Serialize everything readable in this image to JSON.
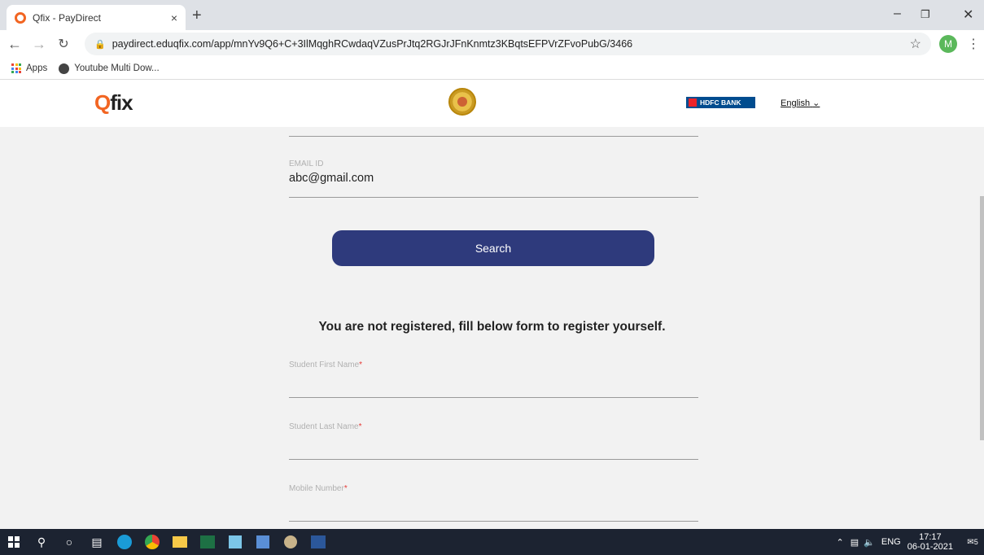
{
  "browser": {
    "tab_title": "Qfix - PayDirect",
    "tab_close": "×",
    "new_tab": "+",
    "url": "paydirect.eduqfix.com/app/mnYv9Q6+C+3IlMqghRCwdaqVZusPrJtq2RGJrJFnKnmtz3KBqtsEFPVrZFvoPubG/3466",
    "profile_initial": "M",
    "bookmarks": [
      {
        "label": "Apps",
        "icon": "apps-grid-icon"
      },
      {
        "label": "Youtube Multi Dow...",
        "icon": "globe-icon"
      }
    ]
  },
  "site_header": {
    "logo_q": "Q",
    "logo_rest": "fix",
    "bank_label": "HDFC BANK",
    "language": "English"
  },
  "form": {
    "email_label": "EMAIL ID",
    "email_value": "abc@gmail.com",
    "search_label": "Search",
    "notice": "You are not registered, fill below form to register yourself.",
    "fields": [
      {
        "label": "Student First Name",
        "required": "*"
      },
      {
        "label": "Student Last Name",
        "required": "*"
      },
      {
        "label": "Mobile Number",
        "required": "*"
      }
    ]
  },
  "taskbar": {
    "lang": "ENG",
    "time": "17:17",
    "date": "06-01-2021",
    "notifications": "5"
  },
  "colors": {
    "brand_orange": "#f26522",
    "button_navy": "#2e3a7c",
    "hdfc_blue": "#004c8f",
    "required_red": "#e53935"
  }
}
